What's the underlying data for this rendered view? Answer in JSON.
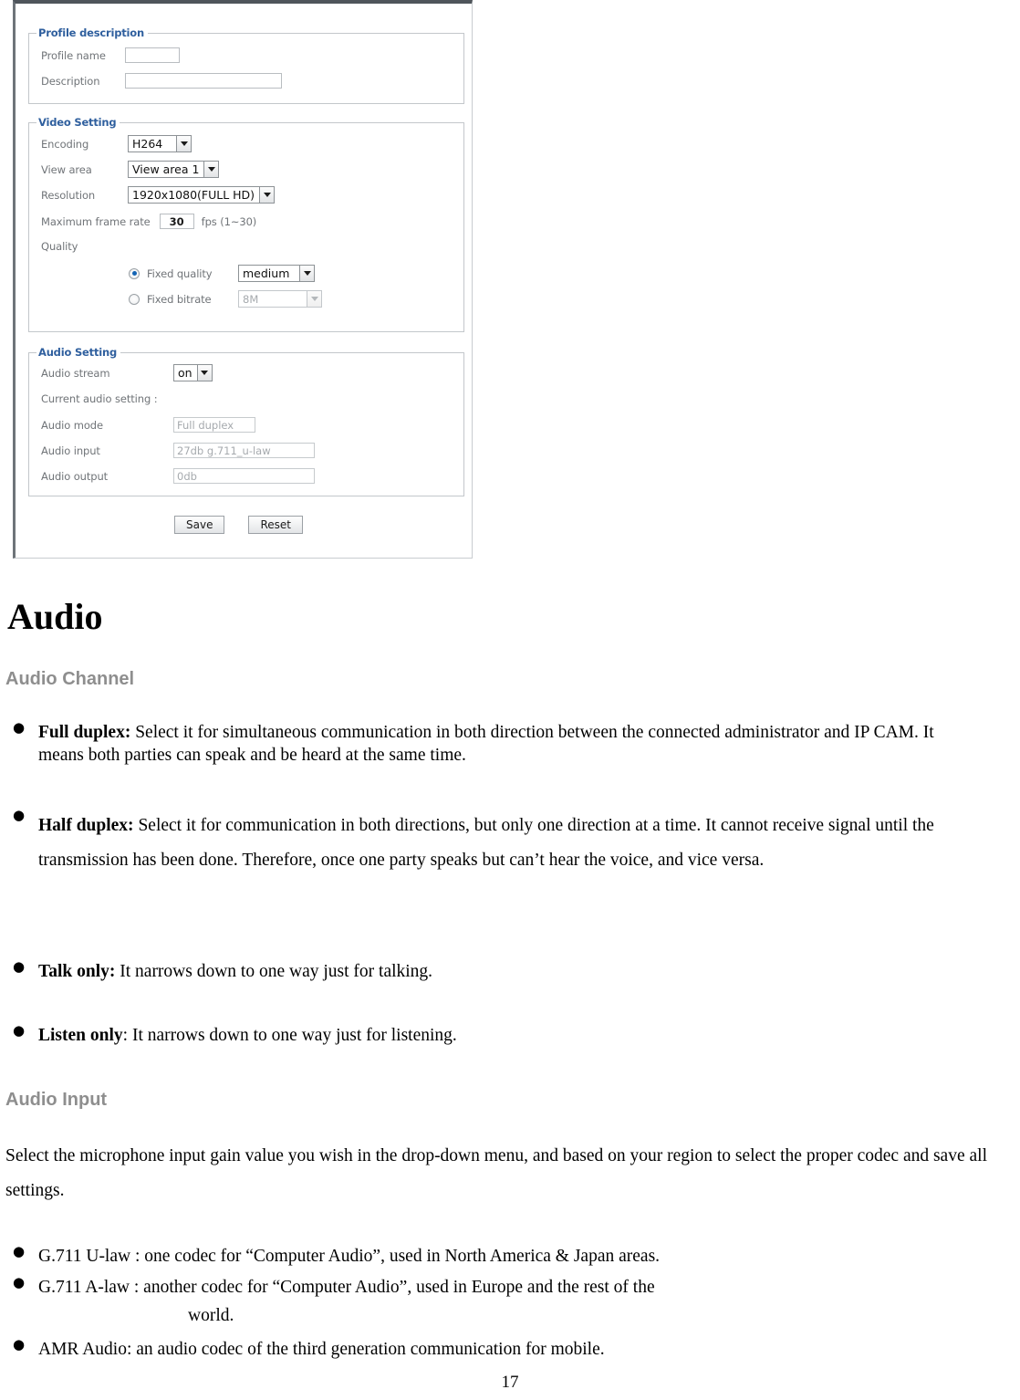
{
  "screenshot": {
    "profile_description": {
      "legend": "Profile description",
      "fields": [
        {
          "label": "Profile name",
          "value": ""
        },
        {
          "label": "Description",
          "value": ""
        }
      ]
    },
    "video_setting": {
      "legend": "Video Setting",
      "encoding_label": "Encoding",
      "encoding_value": "H264",
      "view_area_label": "View area",
      "view_area_value": "View area 1",
      "resolution_label": "Resolution",
      "resolution_value": "1920x1080(FULL HD)",
      "frame_rate_label": "Maximum frame rate",
      "frame_rate_value": "30",
      "frame_rate_unit": "fps (1~30)",
      "quality_label": "Quality",
      "fixed_quality_label": "Fixed quality",
      "fixed_quality_value": "medium",
      "fixed_bitrate_label": "Fixed bitrate",
      "fixed_bitrate_value": "8M"
    },
    "audio_setting": {
      "legend": "Audio Setting",
      "audio_stream_label": "Audio stream",
      "audio_stream_value": "on",
      "current_label": "Current audio setting :",
      "audio_mode_label": "Audio mode",
      "audio_mode_value": "Full duplex",
      "audio_input_label": "Audio input",
      "audio_input_value": "27db g.711_u-law",
      "audio_output_label": "Audio output",
      "audio_output_value": "0db"
    },
    "buttons": {
      "save": "Save",
      "reset": "Reset"
    }
  },
  "document": {
    "title": "Audio",
    "section_channel": {
      "heading": "Audio Channel",
      "bullets": [
        {
          "term": "Full duplex:",
          "text": " Select it for simultaneous communication in both direction between the connected administrator and IP CAM. It means both parties can speak and be heard at the same time."
        },
        {
          "term": "Half duplex:",
          "text": " Select it for communication in both directions, but only one direction at a time. It cannot receive signal until the transmission has been done. Therefore, once one party speaks but can’t hear the voice, and vice versa."
        },
        {
          "term": "Talk only:",
          "text": " It narrows down to one way just for talking."
        },
        {
          "term": "Listen only",
          "text": ": It narrows down to one way just for listening."
        }
      ]
    },
    "section_input": {
      "heading": "Audio Input",
      "paragraph": "Select the microphone input gain value you wish in the drop-down menu, and based on your region to select the proper codec and save all settings.",
      "bullets": [
        {
          "term": "",
          "text": "G.711 U-law : one codec for “Computer Audio”, used in North America & Japan areas."
        },
        {
          "term": "",
          "text": "G.711 A-law : another codec for “Computer Audio”, used in Europe and the rest of the"
        },
        {
          "term": "",
          "text": "world."
        },
        {
          "term": "",
          "text": "AMR Audio: an audio codec of the third generation communication for mobile."
        }
      ]
    },
    "page_number": "17"
  }
}
